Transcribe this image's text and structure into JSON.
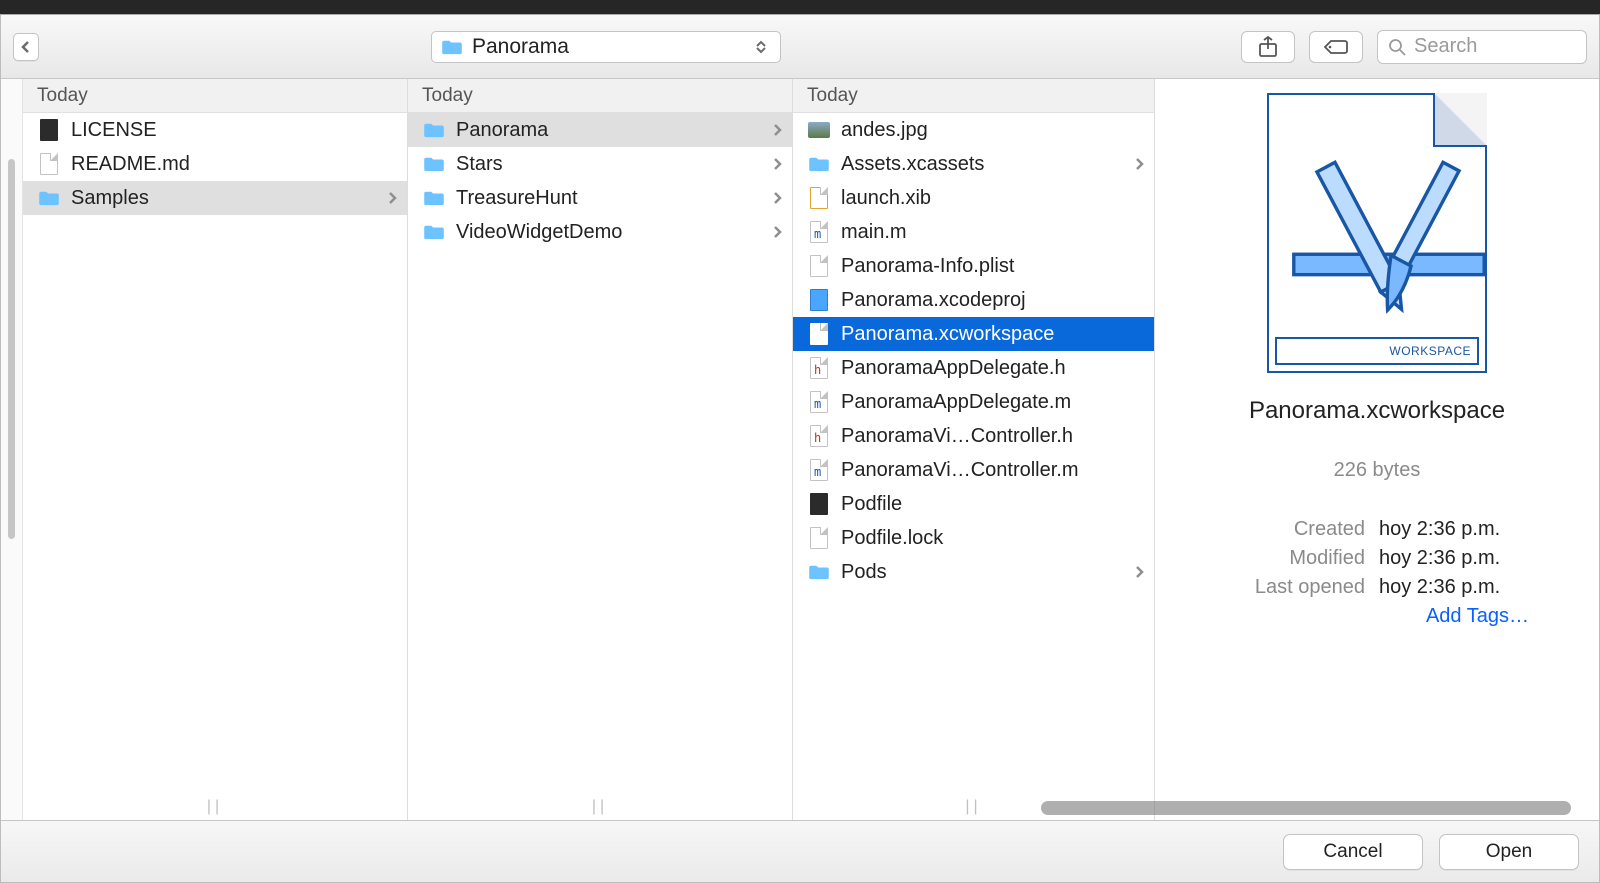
{
  "toolbar": {
    "path_folder": "Panorama",
    "search_placeholder": "Search"
  },
  "columns": {
    "header": "Today",
    "col1": [
      {
        "name": "LICENSE",
        "kind": "dark",
        "chev": false,
        "sel": false
      },
      {
        "name": "README.md",
        "kind": "page",
        "chev": false,
        "sel": false
      },
      {
        "name": "Samples",
        "kind": "folder",
        "chev": true,
        "sel": "path"
      }
    ],
    "col2": [
      {
        "name": "Panorama",
        "kind": "folder",
        "chev": true,
        "sel": "path"
      },
      {
        "name": "Stars",
        "kind": "folder",
        "chev": true,
        "sel": false
      },
      {
        "name": "TreasureHunt",
        "kind": "folder",
        "chev": true,
        "sel": false
      },
      {
        "name": "VideoWidgetDemo",
        "kind": "folder",
        "chev": true,
        "sel": false
      }
    ],
    "col3": [
      {
        "name": "andes.jpg",
        "kind": "img",
        "chev": false,
        "sel": false
      },
      {
        "name": "Assets.xcassets",
        "kind": "folder",
        "chev": true,
        "sel": false
      },
      {
        "name": "launch.xib",
        "kind": "xib",
        "chev": false,
        "sel": false
      },
      {
        "name": "main.m",
        "kind": "m",
        "chev": false,
        "sel": false
      },
      {
        "name": "Panorama-Info.plist",
        "kind": "plist",
        "chev": false,
        "sel": false
      },
      {
        "name": "Panorama.xcodeproj",
        "kind": "xcodeproj",
        "chev": false,
        "sel": false
      },
      {
        "name": "Panorama.xcworkspace",
        "kind": "xcworkspace",
        "chev": false,
        "sel": "selected"
      },
      {
        "name": "PanoramaAppDelegate.h",
        "kind": "h",
        "chev": false,
        "sel": false
      },
      {
        "name": "PanoramaAppDelegate.m",
        "kind": "m",
        "chev": false,
        "sel": false
      },
      {
        "name": "PanoramaVi…Controller.h",
        "kind": "h",
        "chev": false,
        "sel": false
      },
      {
        "name": "PanoramaVi…Controller.m",
        "kind": "m",
        "chev": false,
        "sel": false
      },
      {
        "name": "Podfile",
        "kind": "dark",
        "chev": false,
        "sel": false
      },
      {
        "name": "Podfile.lock",
        "kind": "page",
        "chev": false,
        "sel": false
      },
      {
        "name": "Pods",
        "kind": "folder",
        "chev": true,
        "sel": false
      }
    ]
  },
  "preview": {
    "workspace_label": "WORKSPACE",
    "name": "Panorama.xcworkspace",
    "size": "226 bytes",
    "labels": {
      "created": "Created",
      "modified": "Modified",
      "last_opened": "Last opened"
    },
    "created": "hoy 2:36 p.m.",
    "modified": "hoy 2:36 p.m.",
    "last_opened": "hoy 2:36 p.m.",
    "add_tags": "Add Tags…"
  },
  "footer": {
    "cancel": "Cancel",
    "open": "Open"
  }
}
